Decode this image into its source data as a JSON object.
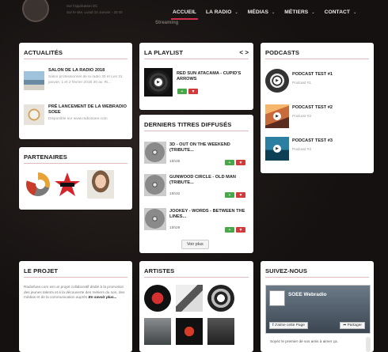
{
  "header": {
    "meta_line1": "Sur l'application DC",
    "meta_line2": "Sur le site, Lundi 15 Janvier - 20:45",
    "sub_logo": "Streaming",
    "nav": [
      {
        "label": "ACCUEIL",
        "active": true,
        "has_menu": false
      },
      {
        "label": "LA RADIO",
        "active": false,
        "has_menu": true
      },
      {
        "label": "MÉDIAS",
        "active": false,
        "has_menu": true
      },
      {
        "label": "MÉTIERS",
        "active": false,
        "has_menu": true
      },
      {
        "label": "CONTACT",
        "active": false,
        "has_menu": true
      }
    ]
  },
  "actualites": {
    "title": "ACTUALITÉS",
    "items": [
      {
        "title": "SALON DE LA RADIO 2018",
        "desc": "Salon professionnel de la radio 30 et Les 31 janvier, 1 et 2 février 2018 30 av. Ri..."
      },
      {
        "title": "PRÉ LANCEMENT DE LA WEBRADIO SOEE",
        "desc": "Disponible sur www.radiosoee.com"
      }
    ]
  },
  "partenaires": {
    "title": "PARTENAIRES"
  },
  "playlist": {
    "title": "LA PLAYLIST",
    "nav_prev": "<",
    "nav_next": ">",
    "track": {
      "title": "RED SUN ATACAMA - CUPID'S ARROWS"
    }
  },
  "derniers": {
    "title": "DERNIERS TITRES DIFFUSÉS",
    "items": [
      {
        "title": "3D - OUT ON THE WEEKEND (TRIBUTE...",
        "time": "15h35"
      },
      {
        "title": "GUNWOOD CIRCLE - OLD MAN (TRIBUTE...",
        "time": "15h32"
      },
      {
        "title": "JOOKEY - WORDS - BETWEEN THE LINES...",
        "time": "15h29"
      }
    ],
    "more": "Voir plus"
  },
  "podcasts": {
    "title": "PODCASTS",
    "items": [
      {
        "title": "PODCAST TEST #1",
        "sub": "Podcast #1"
      },
      {
        "title": "PODCAST TEST #2",
        "sub": "Podcast #2"
      },
      {
        "title": "PODCAST TEST #3",
        "sub": "Podcast #3"
      }
    ]
  },
  "projet": {
    "title": "LE PROJET",
    "text": "Radiofuse.com est un projet collaboratif dédié à la promotion des jeunes talents et à la découverte des métiers du son, des médias et de la communication auprès",
    "link": "En savoir plus..."
  },
  "artistes": {
    "title": "ARTISTES"
  },
  "suivez": {
    "title": "SUIVEZ-NOUS",
    "page_name": "SOEE Webradio",
    "like_label": "J'aime cette Page",
    "share_label": "Partager",
    "friend_text": "Soyez le premier de vos amis à aimer ça."
  },
  "colors": {
    "accent": "#d0304b",
    "background": "#141110"
  }
}
